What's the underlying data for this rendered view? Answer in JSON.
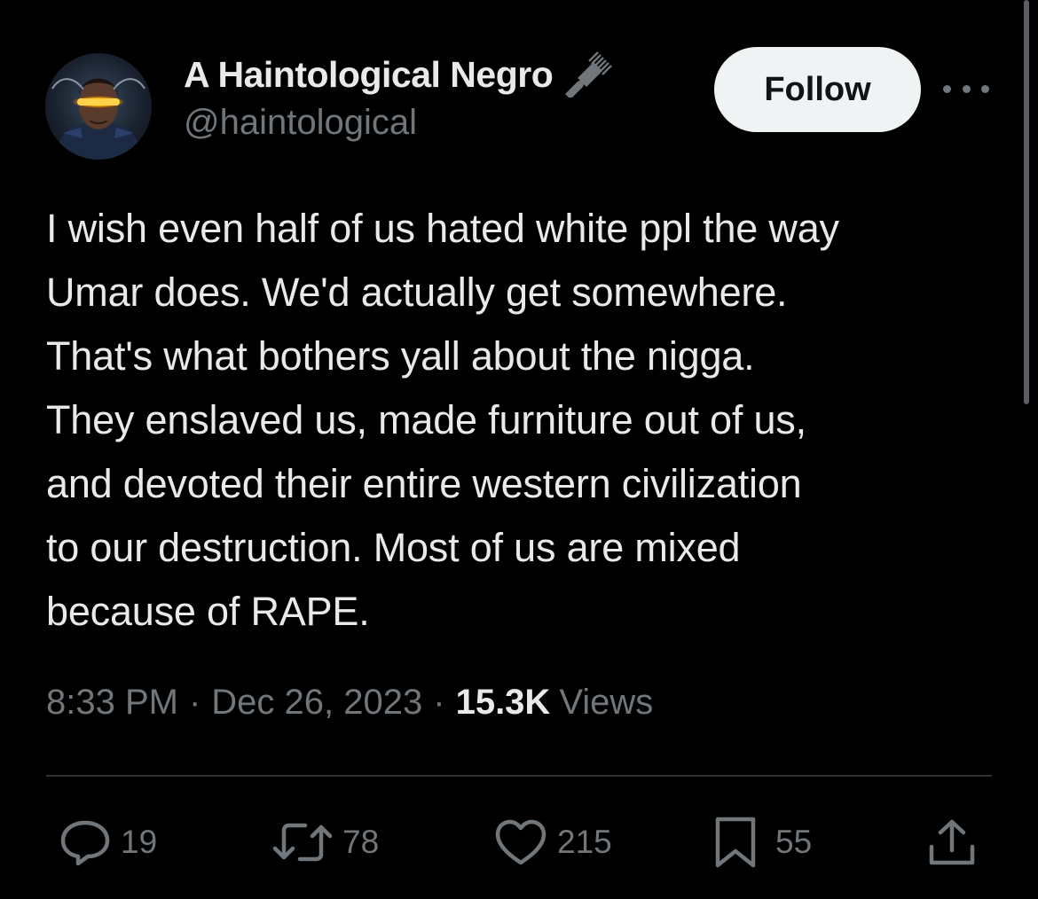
{
  "author": {
    "display_name": "A Haintological Negro",
    "handle": "@haintological",
    "badge_icon": "afro-pick-icon"
  },
  "header": {
    "follow_label": "Follow",
    "more_icon": "more-horizontal-icon"
  },
  "tweet": {
    "text": "I wish even half of us hated white ppl the way\nUmar does. We'd actually get somewhere.\nThat's what bothers yall about the nigga.\nThey enslaved us, made furniture out of us,\nand devoted their entire western civilization\nto our destruction. Most of us are mixed\nbecause of RAPE."
  },
  "meta": {
    "time": "8:33 PM",
    "separator": "·",
    "date": "Dec 26, 2023",
    "views_count": "15.3K",
    "views_label": "Views"
  },
  "actions": {
    "replies": "19",
    "reposts": "78",
    "likes": "215",
    "bookmarks": "55"
  },
  "colors": {
    "background": "#000000",
    "text_primary": "#e7e9ea",
    "text_secondary": "#71767b",
    "divider": "#2f3336",
    "follow_bg": "#eff3f4",
    "follow_text": "#0f1419"
  }
}
